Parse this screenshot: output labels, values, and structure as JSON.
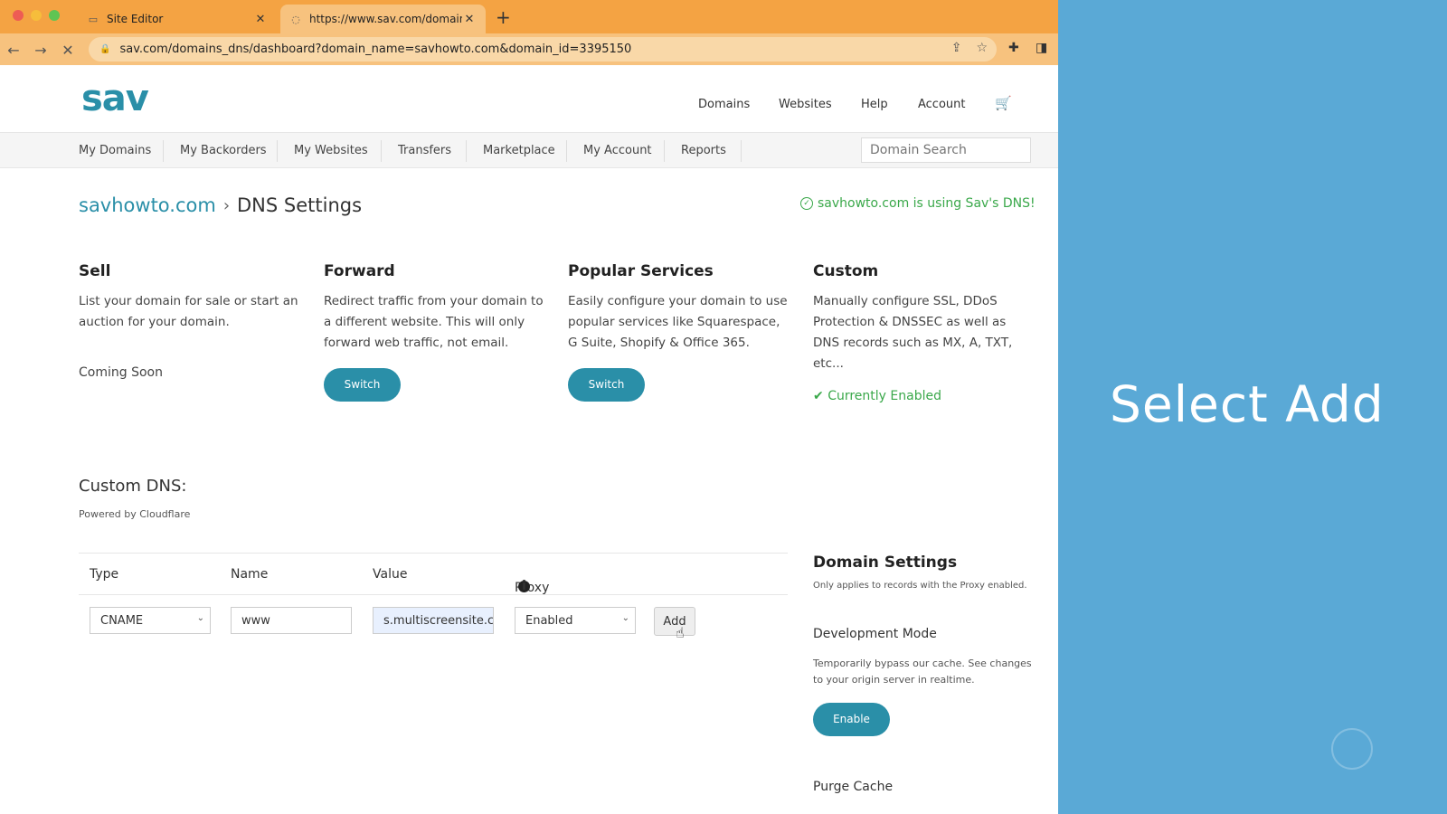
{
  "browser": {
    "tabs": [
      {
        "title": "Site Editor",
        "active": false
      },
      {
        "title": "https://www.sav.com/domains",
        "active": true
      }
    ],
    "url": "sav.com/domains_dns/dashboard?domain_name=savhowto.com&domain_id=3395150"
  },
  "site": {
    "logo": "sav",
    "topnav": [
      "Domains",
      "Websites",
      "Help",
      "Account"
    ],
    "subnav": [
      "My Domains",
      "My Backorders",
      "My Websites",
      "Transfers",
      "Marketplace",
      "My Account",
      "Reports"
    ],
    "search_placeholder": "Domain Search"
  },
  "page": {
    "breadcrumb_domain": "savhowto.com",
    "breadcrumb_current": "DNS Settings",
    "dns_status": "savhowto.com is using Sav's DNS!"
  },
  "cards": {
    "sell": {
      "title": "Sell",
      "text": "List your domain for sale or start an auction for your domain.",
      "note": "Coming Soon"
    },
    "forward": {
      "title": "Forward",
      "text": "Redirect traffic from your domain to a different website. This will only forward web traffic, not email.",
      "button": "Switch"
    },
    "popular": {
      "title": "Popular Services",
      "text": "Easily configure your domain to use popular services like Squarespace, G Suite, Shopify & Office 365.",
      "button": "Switch"
    },
    "custom": {
      "title": "Custom",
      "text": "Manually configure SSL, DDoS Protection & DNSSEC as well as DNS records such as MX, A, TXT, etc...",
      "status": "Currently Enabled"
    }
  },
  "custom_dns": {
    "title": "Custom DNS:",
    "subtitle": "Powered by Cloudflare",
    "headers": {
      "type": "Type",
      "name": "Name",
      "value": "Value",
      "proxy": "Proxy"
    },
    "row": {
      "type": "CNAME",
      "name": "www",
      "value": "s.multiscreensite.cc",
      "proxy": "Enabled",
      "add": "Add"
    }
  },
  "domain_settings": {
    "title": "Domain Settings",
    "hint": "Only applies to records with the Proxy enabled.",
    "dev_mode_title": "Development Mode",
    "dev_mode_desc": "Temporarily bypass our cache. See changes to your origin server in realtime.",
    "enable": "Enable",
    "purge": "Purge Cache"
  },
  "overlay": {
    "caption": "Select Add"
  },
  "colors": {
    "accent": "#2a8fa8",
    "success": "#3aa84a",
    "overlay": "#5aa9d6",
    "tabbar": "#f4a343"
  }
}
